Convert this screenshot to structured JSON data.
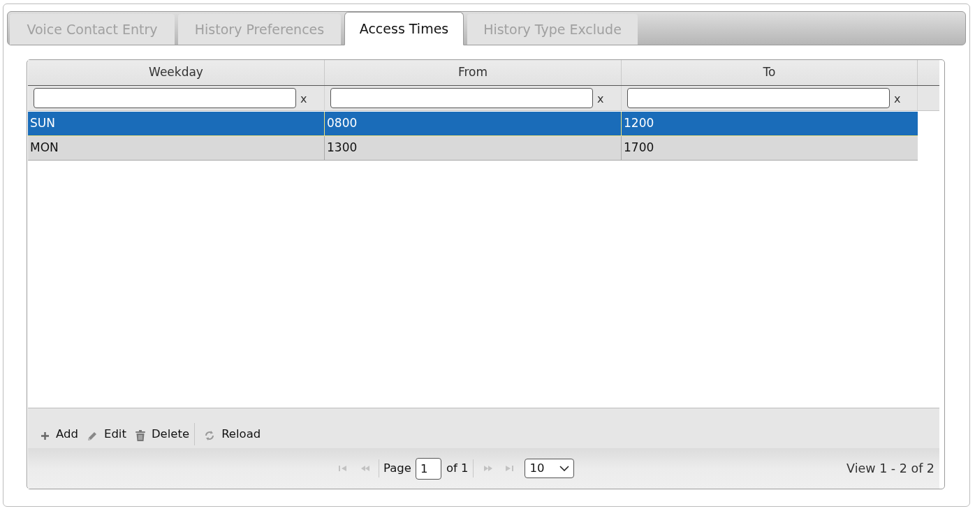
{
  "tabs": [
    {
      "label": "Voice Contact Entry",
      "selected": false
    },
    {
      "label": "History Preferences",
      "selected": false
    },
    {
      "label": "Access Times",
      "selected": true
    },
    {
      "label": "History Type Exclude",
      "selected": false
    }
  ],
  "grid": {
    "columns": [
      "Weekday",
      "From",
      "To"
    ],
    "filters": [
      {
        "clear": "x"
      },
      {
        "clear": "x"
      },
      {
        "clear": "x"
      }
    ],
    "rows": [
      {
        "cells": [
          "SUN",
          "0800",
          "1200"
        ],
        "selected": true
      },
      {
        "cells": [
          "MON",
          "1300",
          "1700"
        ],
        "selected": false
      }
    ]
  },
  "toolbar": {
    "groups": [
      [
        {
          "kind": "add",
          "label": "Add"
        },
        {
          "kind": "edit",
          "label": "Edit"
        },
        {
          "kind": "delete",
          "label": "Delete"
        }
      ],
      [
        {
          "kind": "reload",
          "label": "Reload"
        }
      ]
    ]
  },
  "pager": {
    "nav_before": [
      {
        "kind": "first",
        "disabled": true
      },
      {
        "kind": "prev",
        "disabled": true
      }
    ],
    "page_label": "Page",
    "page": "1",
    "page_count": "of 1",
    "nav_after": [
      {
        "kind": "next",
        "disabled": true
      },
      {
        "kind": "last",
        "disabled": true
      }
    ],
    "page_size": "10",
    "summary": "View 1 - 2 of 2"
  }
}
